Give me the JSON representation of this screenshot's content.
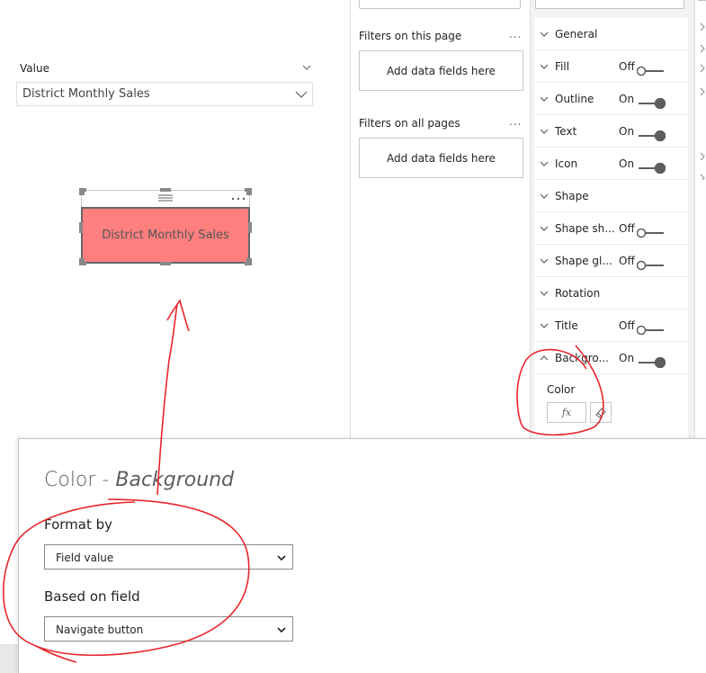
{
  "slicer": {
    "header_label": "Value",
    "selected_value": "District Monthly Sales"
  },
  "visual": {
    "button_text": "District Monthly Sales",
    "fill_color": "#ff7f7f"
  },
  "filters": {
    "this_page_title": "Filters on this page",
    "this_page_placeholder": "Add data fields here",
    "all_pages_title": "Filters on all pages",
    "all_pages_placeholder": "Add data fields here",
    "more_label": "..."
  },
  "format_pane": {
    "cards": [
      {
        "label": "General",
        "state": ""
      },
      {
        "label": "Fill",
        "state": "Off"
      },
      {
        "label": "Outline",
        "state": "On"
      },
      {
        "label": "Text",
        "state": "On"
      },
      {
        "label": "Icon",
        "state": "On"
      },
      {
        "label": "Shape",
        "state": ""
      },
      {
        "label": "Shape sh...",
        "state": "Off"
      },
      {
        "label": "Shape gl...",
        "state": "Off"
      },
      {
        "label": "Rotation",
        "state": ""
      },
      {
        "label": "Title",
        "state": "Off"
      },
      {
        "label": "Backgro...",
        "state": "On"
      }
    ],
    "background": {
      "color_label": "Color",
      "fx_label": "fx"
    }
  },
  "dialog": {
    "title_prefix": "Color - ",
    "title_italic": "Background",
    "format_by_label": "Format by",
    "format_by_value": "Field value",
    "based_on_label": "Based on field",
    "based_on_value": "Navigate button"
  },
  "colors": {
    "annotation_red": "#e8262b",
    "toggle_on": "#605e5c",
    "pane_bg": "#f3f2f1"
  }
}
